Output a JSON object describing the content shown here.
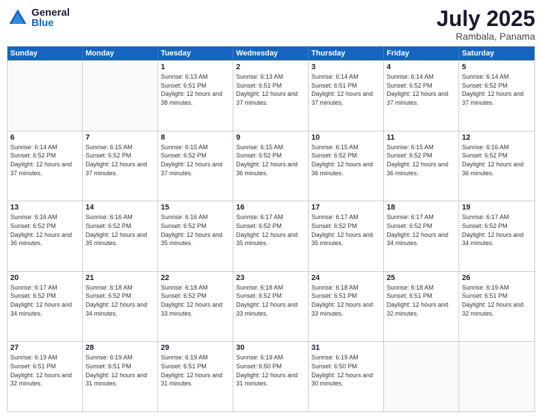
{
  "logo": {
    "general": "General",
    "blue": "Blue"
  },
  "header": {
    "month": "July 2025",
    "location": "Rambala, Panama"
  },
  "weekdays": [
    "Sunday",
    "Monday",
    "Tuesday",
    "Wednesday",
    "Thursday",
    "Friday",
    "Saturday"
  ],
  "rows": [
    [
      {
        "day": "",
        "empty": true
      },
      {
        "day": "",
        "empty": true
      },
      {
        "day": "1",
        "sunrise": "Sunrise: 6:13 AM",
        "sunset": "Sunset: 6:51 PM",
        "daylight": "Daylight: 12 hours and 38 minutes."
      },
      {
        "day": "2",
        "sunrise": "Sunrise: 6:13 AM",
        "sunset": "Sunset: 6:51 PM",
        "daylight": "Daylight: 12 hours and 37 minutes."
      },
      {
        "day": "3",
        "sunrise": "Sunrise: 6:14 AM",
        "sunset": "Sunset: 6:51 PM",
        "daylight": "Daylight: 12 hours and 37 minutes."
      },
      {
        "day": "4",
        "sunrise": "Sunrise: 6:14 AM",
        "sunset": "Sunset: 6:52 PM",
        "daylight": "Daylight: 12 hours and 37 minutes."
      },
      {
        "day": "5",
        "sunrise": "Sunrise: 6:14 AM",
        "sunset": "Sunset: 6:52 PM",
        "daylight": "Daylight: 12 hours and 37 minutes."
      }
    ],
    [
      {
        "day": "6",
        "sunrise": "Sunrise: 6:14 AM",
        "sunset": "Sunset: 6:52 PM",
        "daylight": "Daylight: 12 hours and 37 minutes."
      },
      {
        "day": "7",
        "sunrise": "Sunrise: 6:15 AM",
        "sunset": "Sunset: 6:52 PM",
        "daylight": "Daylight: 12 hours and 37 minutes."
      },
      {
        "day": "8",
        "sunrise": "Sunrise: 6:15 AM",
        "sunset": "Sunset: 6:52 PM",
        "daylight": "Daylight: 12 hours and 37 minutes."
      },
      {
        "day": "9",
        "sunrise": "Sunrise: 6:15 AM",
        "sunset": "Sunset: 6:52 PM",
        "daylight": "Daylight: 12 hours and 36 minutes."
      },
      {
        "day": "10",
        "sunrise": "Sunrise: 6:15 AM",
        "sunset": "Sunset: 6:52 PM",
        "daylight": "Daylight: 12 hours and 36 minutes."
      },
      {
        "day": "11",
        "sunrise": "Sunrise: 6:15 AM",
        "sunset": "Sunset: 6:52 PM",
        "daylight": "Daylight: 12 hours and 36 minutes."
      },
      {
        "day": "12",
        "sunrise": "Sunrise: 6:16 AM",
        "sunset": "Sunset: 6:52 PM",
        "daylight": "Daylight: 12 hours and 36 minutes."
      }
    ],
    [
      {
        "day": "13",
        "sunrise": "Sunrise: 6:16 AM",
        "sunset": "Sunset: 6:52 PM",
        "daylight": "Daylight: 12 hours and 36 minutes."
      },
      {
        "day": "14",
        "sunrise": "Sunrise: 6:16 AM",
        "sunset": "Sunset: 6:52 PM",
        "daylight": "Daylight: 12 hours and 35 minutes."
      },
      {
        "day": "15",
        "sunrise": "Sunrise: 6:16 AM",
        "sunset": "Sunset: 6:52 PM",
        "daylight": "Daylight: 12 hours and 35 minutes."
      },
      {
        "day": "16",
        "sunrise": "Sunrise: 6:17 AM",
        "sunset": "Sunset: 6:52 PM",
        "daylight": "Daylight: 12 hours and 35 minutes."
      },
      {
        "day": "17",
        "sunrise": "Sunrise: 6:17 AM",
        "sunset": "Sunset: 6:52 PM",
        "daylight": "Daylight: 12 hours and 35 minutes."
      },
      {
        "day": "18",
        "sunrise": "Sunrise: 6:17 AM",
        "sunset": "Sunset: 6:52 PM",
        "daylight": "Daylight: 12 hours and 34 minutes."
      },
      {
        "day": "19",
        "sunrise": "Sunrise: 6:17 AM",
        "sunset": "Sunset: 6:52 PM",
        "daylight": "Daylight: 12 hours and 34 minutes."
      }
    ],
    [
      {
        "day": "20",
        "sunrise": "Sunrise: 6:17 AM",
        "sunset": "Sunset: 6:52 PM",
        "daylight": "Daylight: 12 hours and 34 minutes."
      },
      {
        "day": "21",
        "sunrise": "Sunrise: 6:18 AM",
        "sunset": "Sunset: 6:52 PM",
        "daylight": "Daylight: 12 hours and 34 minutes."
      },
      {
        "day": "22",
        "sunrise": "Sunrise: 6:18 AM",
        "sunset": "Sunset: 6:52 PM",
        "daylight": "Daylight: 12 hours and 33 minutes."
      },
      {
        "day": "23",
        "sunrise": "Sunrise: 6:18 AM",
        "sunset": "Sunset: 6:52 PM",
        "daylight": "Daylight: 12 hours and 33 minutes."
      },
      {
        "day": "24",
        "sunrise": "Sunrise: 6:18 AM",
        "sunset": "Sunset: 6:51 PM",
        "daylight": "Daylight: 12 hours and 33 minutes."
      },
      {
        "day": "25",
        "sunrise": "Sunrise: 6:18 AM",
        "sunset": "Sunset: 6:51 PM",
        "daylight": "Daylight: 12 hours and 32 minutes."
      },
      {
        "day": "26",
        "sunrise": "Sunrise: 6:19 AM",
        "sunset": "Sunset: 6:51 PM",
        "daylight": "Daylight: 12 hours and 32 minutes."
      }
    ],
    [
      {
        "day": "27",
        "sunrise": "Sunrise: 6:19 AM",
        "sunset": "Sunset: 6:51 PM",
        "daylight": "Daylight: 12 hours and 32 minutes."
      },
      {
        "day": "28",
        "sunrise": "Sunrise: 6:19 AM",
        "sunset": "Sunset: 6:51 PM",
        "daylight": "Daylight: 12 hours and 31 minutes."
      },
      {
        "day": "29",
        "sunrise": "Sunrise: 6:19 AM",
        "sunset": "Sunset: 6:51 PM",
        "daylight": "Daylight: 12 hours and 31 minutes."
      },
      {
        "day": "30",
        "sunrise": "Sunrise: 6:19 AM",
        "sunset": "Sunset: 6:50 PM",
        "daylight": "Daylight: 12 hours and 31 minutes."
      },
      {
        "day": "31",
        "sunrise": "Sunrise: 6:19 AM",
        "sunset": "Sunset: 6:50 PM",
        "daylight": "Daylight: 12 hours and 30 minutes."
      },
      {
        "day": "",
        "empty": true
      },
      {
        "day": "",
        "empty": true
      }
    ]
  ]
}
